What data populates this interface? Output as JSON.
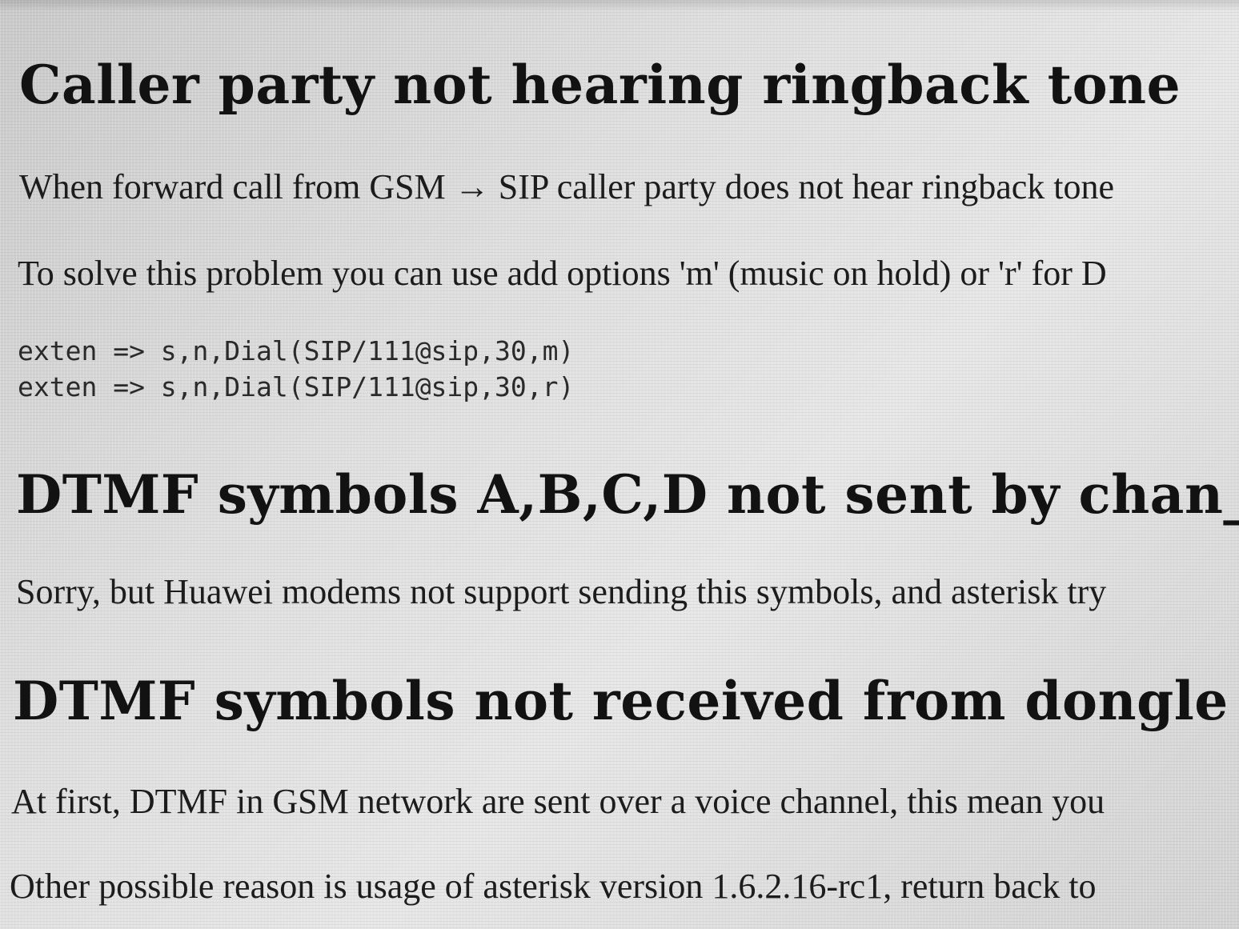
{
  "sections": [
    {
      "heading": "Caller party not hearing ringback tone",
      "paragraphs": [
        "When forward call from GSM → SIP caller party does not hear ringback tone",
        "To solve this problem you can use add options 'm' (music on hold) or 'r' for D"
      ],
      "code": [
        "exten => s,n,Dial(SIP/111@sip,30,m)",
        "exten => s,n,Dial(SIP/111@sip,30,r)"
      ]
    },
    {
      "heading": "DTMF symbols A,B,C,D not sent by chan_dongle",
      "paragraphs": [
        "Sorry, but Huawei modems not support sending this symbols, and asterisk try"
      ]
    },
    {
      "heading": "DTMF symbols not received from dongle",
      "paragraphs": [
        "At first, DTMF in GSM network are sent over a voice channel, this mean you",
        "Other possible reason is usage of asterisk version 1.6.2.16-rc1, return back to"
      ]
    }
  ]
}
